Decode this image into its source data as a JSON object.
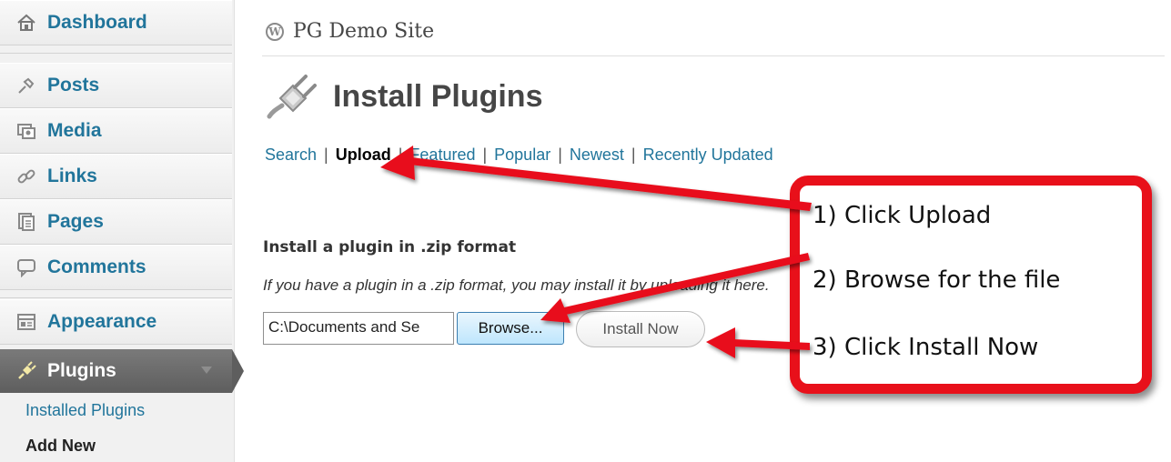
{
  "sidebar": {
    "items": [
      {
        "label": "Dashboard",
        "icon": "dashboard-icon"
      },
      {
        "label": "Posts",
        "icon": "posts-pin-icon"
      },
      {
        "label": "Media",
        "icon": "media-icon"
      },
      {
        "label": "Links",
        "icon": "links-icon"
      },
      {
        "label": "Pages",
        "icon": "pages-icon"
      },
      {
        "label": "Comments",
        "icon": "comments-icon"
      },
      {
        "label": "Appearance",
        "icon": "appearance-icon"
      },
      {
        "label": "Plugins",
        "icon": "plugins-icon"
      }
    ],
    "submenu": [
      {
        "label": "Installed Plugins"
      },
      {
        "label": "Add New"
      }
    ]
  },
  "header": {
    "site_name": "PG Demo Site",
    "logo_letter": "W"
  },
  "page": {
    "title": "Install Plugins"
  },
  "tabs": [
    {
      "label": "Search"
    },
    {
      "label": "Upload"
    },
    {
      "label": "Featured"
    },
    {
      "label": "Popular"
    },
    {
      "label": "Newest"
    },
    {
      "label": "Recently Updated"
    }
  ],
  "upload": {
    "heading": "Install a plugin in .zip format",
    "description": "If you have a plugin in a .zip format, you may install it by uploading it here.",
    "file_value": "C:\\Documents and Se",
    "browse_label": "Browse...",
    "install_label": "Install Now"
  },
  "callout": {
    "steps": [
      "1) Click Upload",
      "2) Browse for the file",
      "3) Click Install Now"
    ]
  },
  "colors": {
    "link": "#21759b",
    "annotation_red": "#e8101a",
    "active_menu": "#6d6d6d"
  }
}
